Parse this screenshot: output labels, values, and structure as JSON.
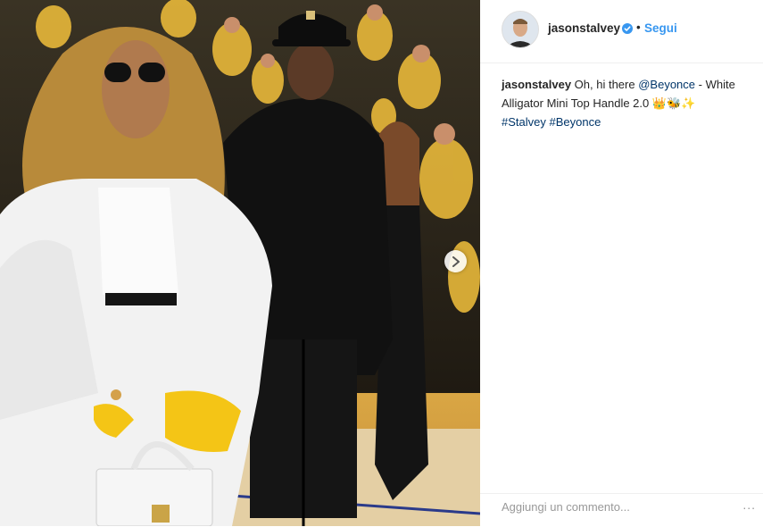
{
  "post": {
    "image_alt": "",
    "next_icon": "chevron-right-icon"
  },
  "header": {
    "username": "jasonstalvey",
    "verified_icon": "verified-badge-icon",
    "separator": "•",
    "follow_label": "Segui"
  },
  "caption": {
    "username": "jasonstalvey",
    "text_before": "Oh, hi there",
    "mention": "@Beyonce",
    "text_after": "- White Alligator Mini Top Handle 2.0 👑🐝✨",
    "hashtags": [
      "#Stalvey",
      "#Beyonce"
    ]
  },
  "comment": {
    "placeholder": "Aggiungi un commento...",
    "more_icon": "more-options-icon",
    "more_label": "..."
  },
  "colors": {
    "link": "#003569",
    "follow": "#3897f0",
    "verified": "#3897f0",
    "text": "#262626",
    "court_yellow": "#f1b52a"
  }
}
